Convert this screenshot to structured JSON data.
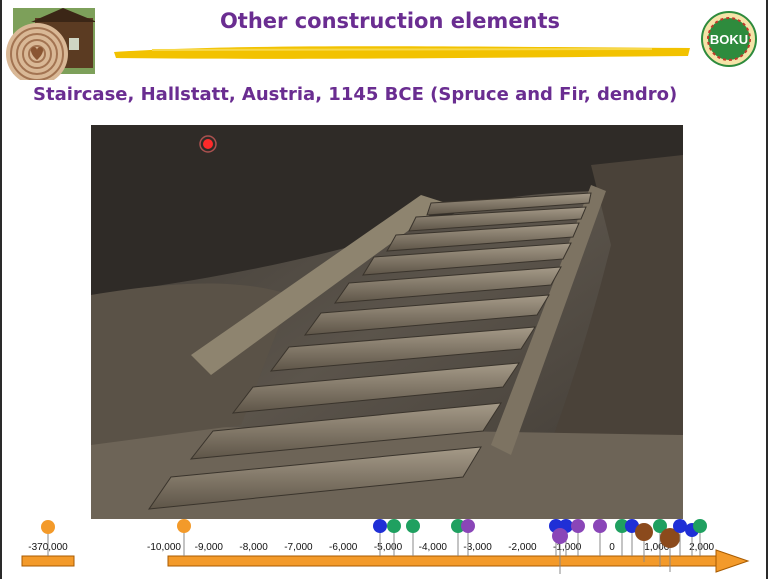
{
  "header": {
    "title": "Other construction elements",
    "subtitle": "Staircase, Hallstatt, Austria, 1145 BCE (Spruce and Fir, dendro)",
    "logo_right_text": "BOKU"
  },
  "colors": {
    "title": "#6a2d91",
    "brush": "#f2c200",
    "timeline_bar": "#f39a2a",
    "logo_green": "#2e8b3d"
  },
  "photo": {
    "description_icon": "staircase-photo"
  },
  "timeline": {
    "left_label": "-370,000",
    "labels": [
      "-10,000",
      "-9,000",
      "-8,000",
      "-7,000",
      "-6,000",
      "-5,000",
      "-4,000",
      "-3,000",
      "-2,000",
      "-1,000",
      "0",
      "1,000",
      "2,000"
    ]
  }
}
